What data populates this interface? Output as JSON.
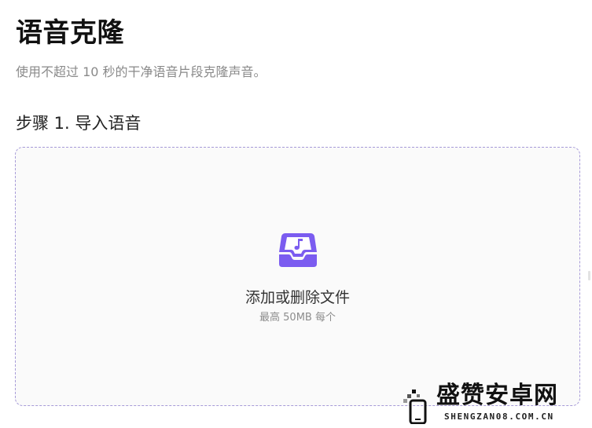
{
  "header": {
    "title": "语音克隆",
    "subtitle": "使用不超过 10 秒的干净语音片段克隆声音。"
  },
  "step1": {
    "title": "步骤 1. 导入语音"
  },
  "dropzone": {
    "icon": "audio-inbox-icon",
    "label": "添加或删除文件",
    "hint": "最高 50MB 每个"
  },
  "watermark": {
    "text": "盛赞安卓网",
    "domain": "SHENGZAN08.COM.CN"
  },
  "colors": {
    "accent": "#7b5cf0",
    "dropzone_border": "#a69ad8",
    "subtitle_text": "#8a8a8a"
  }
}
